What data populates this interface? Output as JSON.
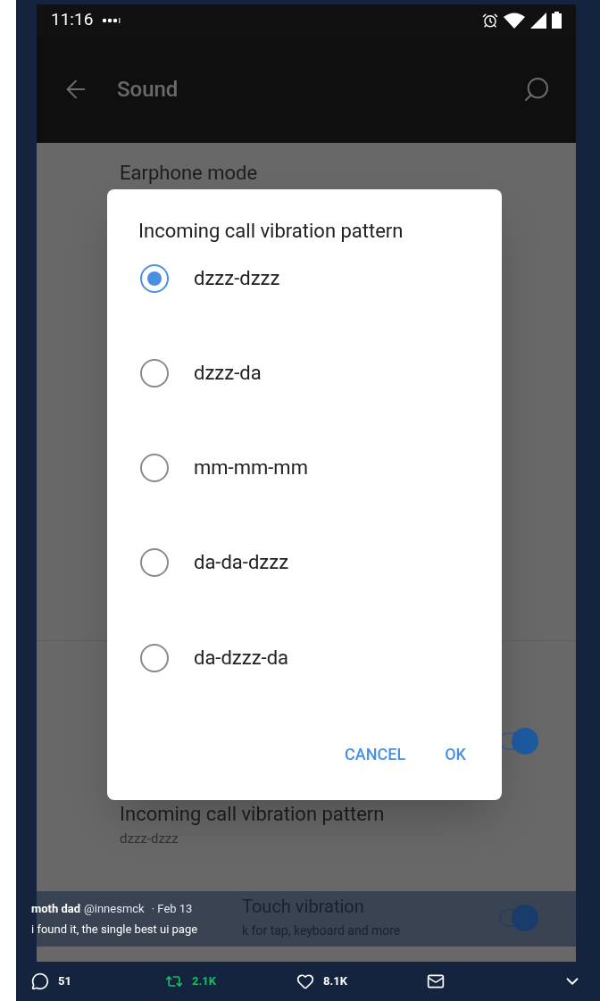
{
  "status_bar": {
    "time": "11:16"
  },
  "toolbar": {
    "title": "Sound"
  },
  "settings": [
    {
      "kind": "text",
      "title": "Earphone mode"
    },
    {
      "kind": "toggle",
      "on": true
    },
    {
      "kind": "text",
      "title": "Incoming call vibration pattern",
      "subtitle": "dzzz-dzzz"
    },
    {
      "kind": "toggle_text",
      "title": "Touch vibration",
      "subtitle": "k for tap, keyboard and more",
      "on": true
    }
  ],
  "dialog": {
    "title": "Incoming call vibration pattern",
    "options": [
      {
        "label": "dzzz-dzzz",
        "selected": true
      },
      {
        "label": "dzzz-da",
        "selected": false
      },
      {
        "label": "mm-mm-mm",
        "selected": false
      },
      {
        "label": "da-da-dzzz",
        "selected": false
      },
      {
        "label": "da-dzzz-da",
        "selected": false
      }
    ],
    "buttons": [
      "CANCEL",
      "OK"
    ]
  },
  "tweet": {
    "name": "moth dad",
    "handle": "@innesmck",
    "date": "· Feb 13",
    "text": "i found it, the single best ui page"
  },
  "actions": [
    {
      "kind": "reply",
      "count": "51"
    },
    {
      "kind": "retweet",
      "count": "2.1K"
    },
    {
      "kind": "like",
      "count": "8.1K"
    },
    {
      "kind": "message"
    },
    {
      "kind": "more"
    }
  ]
}
